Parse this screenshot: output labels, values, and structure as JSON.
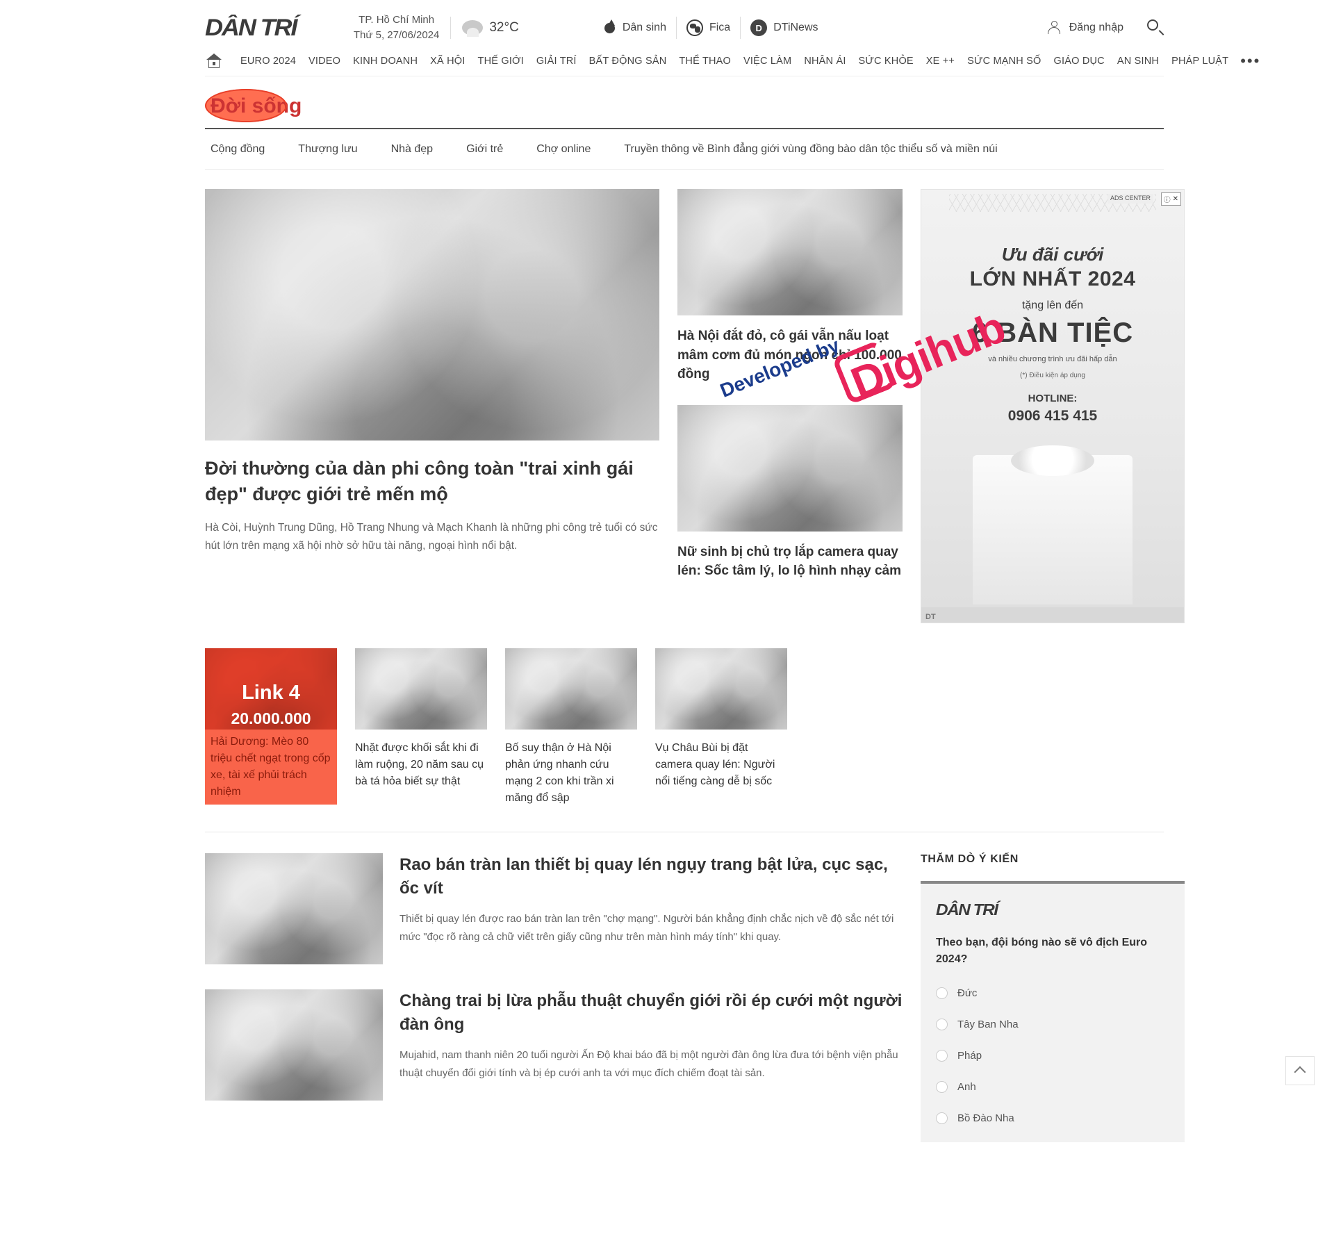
{
  "header": {
    "logo": "DÂN TRÍ",
    "city": "TP. Hồ Chí Minh",
    "date": "Thứ 5, 27/06/2024",
    "temperature": "32°C",
    "weather_icon": "cloud-icon",
    "brands": [
      {
        "label": "Dân sinh",
        "icon": "drop-icon"
      },
      {
        "label": "Fica",
        "icon": "globe-icon"
      },
      {
        "label": "DTiNews",
        "icon": "d-circle-icon"
      }
    ],
    "login_label": "Đăng nhập",
    "search_icon": "search-icon"
  },
  "nav": {
    "home_icon": "home-icon",
    "items": [
      "EURO 2024",
      "VIDEO",
      "KINH DOANH",
      "XÃ HỘI",
      "THẾ GIỚI",
      "GIẢI TRÍ",
      "BẤT ĐỘNG SẢN",
      "THỂ THAO",
      "VIỆC LÀM",
      "NHÂN ÁI",
      "SỨC KHỎE",
      "XE ++",
      "SỨC MẠNH SỐ",
      "GIÁO DỤC",
      "AN SINH",
      "PHÁP LUẬT"
    ],
    "more": "•••"
  },
  "category": {
    "title": "Đời sống",
    "highlight_color": "#ff5533",
    "subtabs": [
      "Cộng đồng",
      "Thượng lưu",
      "Nhà đẹp",
      "Giới trẻ",
      "Chợ online",
      "Truyền thông về Bình đẳng giới vùng đồng bào dân tộc thiểu số và miền núi"
    ]
  },
  "lead": {
    "title": "Đời thường của dàn phi công toàn \"trai xinh gái đẹp\" được giới trẻ mến mộ",
    "sapo": "Hà Còi, Huỳnh Trung Dũng, Hồ Trang Nhung và Mạch Khanh là những phi công trẻ tuổi có sức hút lớn trên mạng xã hội nhờ sở hữu tài năng, ngoại hình nổi bật."
  },
  "mid_articles": [
    {
      "title": "Hà Nội đắt đỏ, cô gái vẫn nấu loạt mâm cơm đủ món ngon chỉ 100.000 đồng"
    },
    {
      "title": "Nữ sinh bị chủ trọ lắp camera quay lén: Sốc tâm lý, lo lộ hình nhạy cảm"
    }
  ],
  "ad": {
    "line1": "Ưu đãi cưới",
    "line2": "LỚN NHẤT 2024",
    "line3": "tặng lên đến",
    "line4": "6 BÀN TIỆC",
    "line5": "và nhiều chương trình ưu đãi hấp dẫn",
    "line6": "(*) Điều kiện áp dụng",
    "hotline_label": "HOTLINE:",
    "phone": "0906 415 415",
    "close": "✕",
    "info": "ⓘ",
    "brand_tag": "ADS CENTER",
    "footer_tag": "DT"
  },
  "watermark": {
    "text": "Developed by",
    "logo": "Digihub",
    "text_color": "#1b3c8c",
    "logo_color": "#e8245a"
  },
  "cards": [
    {
      "title": "Hải Dương: Mèo 80 triệu chết ngạt trong cốp xe, tài xế phủi trách nhiệm",
      "highlighted": true,
      "overlay_line1": "Link 4",
      "overlay_line2": "20.000.000"
    },
    {
      "title": "Nhặt được khối sắt khi đi làm ruộng, 20 năm sau cụ bà tá hỏa biết sự thật",
      "highlighted": false
    },
    {
      "title": "Bố suy thận ở Hà Nội phản ứng nhanh cứu mạng 2 con khi trần xi măng đổ sập",
      "highlighted": false
    },
    {
      "title": "Vụ Châu Bùi bị đặt camera quay lén: Người nổi tiếng càng dễ bị sốc",
      "highlighted": false
    }
  ],
  "lower_rows": [
    {
      "title": "Rao bán tràn lan thiết bị quay lén ngụy trang bật lửa, cục sạc, ốc vít",
      "sapo": "Thiết bị quay lén được rao bán tràn lan trên \"chợ mạng\". Người bán khẳng định chắc nịch về độ sắc nét tới mức \"đọc rõ ràng cả chữ viết trên giấy cũng như trên màn hình máy tính\" khi quay."
    },
    {
      "title": "Chàng trai bị lừa phẫu thuật chuyển giới rồi ép cưới một người đàn ông",
      "sapo": "Mujahid, nam thanh niên 20 tuổi người Ấn Độ khai báo đã bị một người đàn ông lừa đưa tới bệnh viện phẫu thuật chuyển đổi giới tính và bị ép cưới anh ta với mục đích chiếm đoạt tài sản."
    }
  ],
  "poll": {
    "heading": "THĂM DÒ Ý KIẾN",
    "logo": "DÂN TRÍ",
    "question": "Theo bạn, đội bóng nào sẽ vô địch Euro 2024?",
    "options": [
      "Đức",
      "Tây Ban Nha",
      "Pháp",
      "Anh",
      "Bồ Đào Nha"
    ]
  },
  "back_to_top_icon": "chevron-up-icon"
}
